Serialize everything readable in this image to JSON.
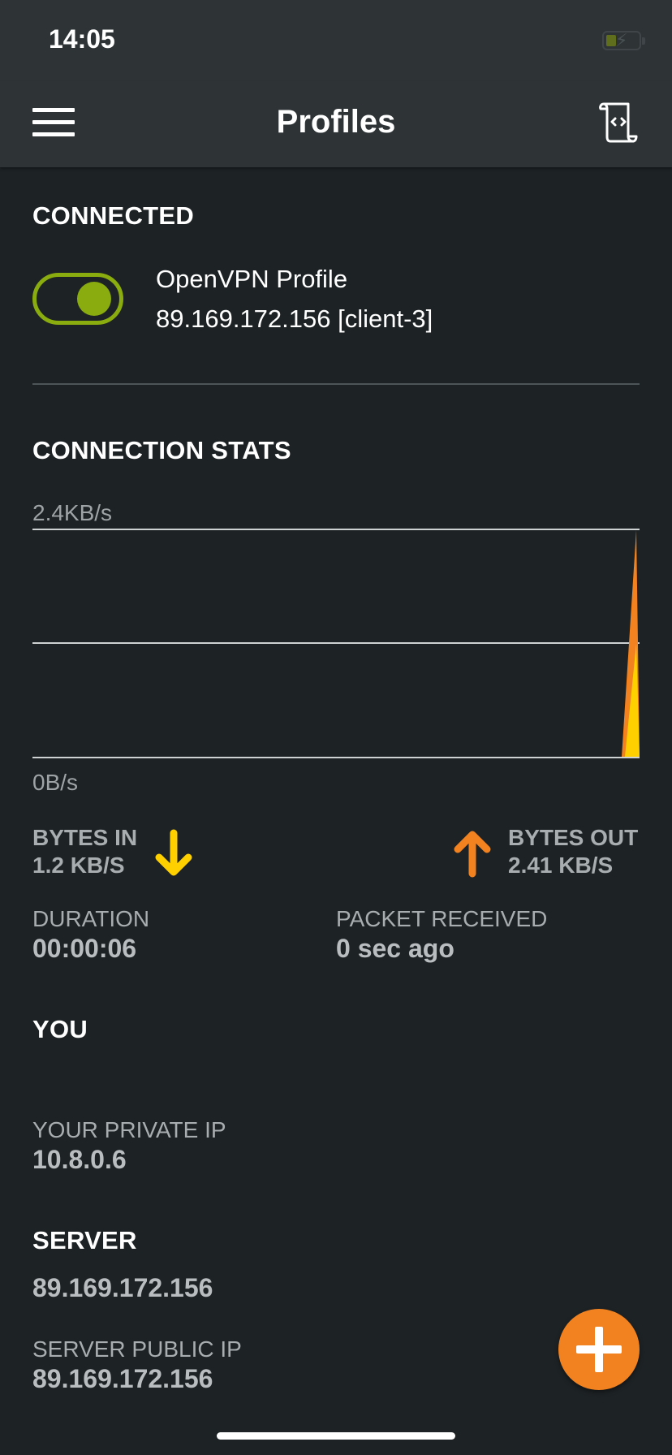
{
  "status_bar": {
    "time": "14:05"
  },
  "header": {
    "title": "Profiles"
  },
  "connected": {
    "heading": "CONNECTED",
    "profile_name": "OpenVPN Profile",
    "profile_detail": "89.169.172.156 [client-3]",
    "toggle_on": true
  },
  "stats": {
    "heading": "CONNECTION STATS",
    "chart_max_label": "2.4KB/s",
    "chart_min_label": "0B/s",
    "bytes_in_label": "BYTES IN",
    "bytes_in_value": "1.2 KB/S",
    "bytes_out_label": "BYTES OUT",
    "bytes_out_value": "2.41 KB/S",
    "duration_label": "DURATION",
    "duration_value": "00:00:06",
    "packet_label": "PACKET RECEIVED",
    "packet_value": "0 sec ago"
  },
  "chart_data": {
    "type": "area",
    "ylim": [
      0,
      2.4
    ],
    "y_unit": "KB/s",
    "y_tick_labels": [
      "0B/s",
      "2.4KB/s"
    ],
    "grid": true,
    "series": [
      {
        "values": [
          0,
          0,
          0,
          0,
          0,
          0,
          2.41
        ],
        "color": "#f28220"
      },
      {
        "values": [
          0,
          0,
          0,
          0,
          0,
          0,
          1.2
        ],
        "color": "#ffd000"
      }
    ]
  },
  "you": {
    "heading": "YOU",
    "private_ip_label": "YOUR PRIVATE IP",
    "private_ip_value": "10.8.0.6"
  },
  "server": {
    "heading": "SERVER",
    "address": "89.169.172.156",
    "public_ip_label": "SERVER PUBLIC IP",
    "public_ip_value": "89.169.172.156"
  },
  "icons": {
    "menu": "hamburger-menu-icon",
    "log": "log-scroll-icon",
    "bytes_in": "arrow-down-icon",
    "bytes_out": "arrow-up-icon",
    "add": "plus-icon"
  },
  "colors": {
    "accent_green": "#8aac0e",
    "bytes_in_yellow": "#ffd000",
    "bytes_out_orange": "#f28220",
    "header_bg": "#2e3436",
    "background": "#1d2224"
  }
}
